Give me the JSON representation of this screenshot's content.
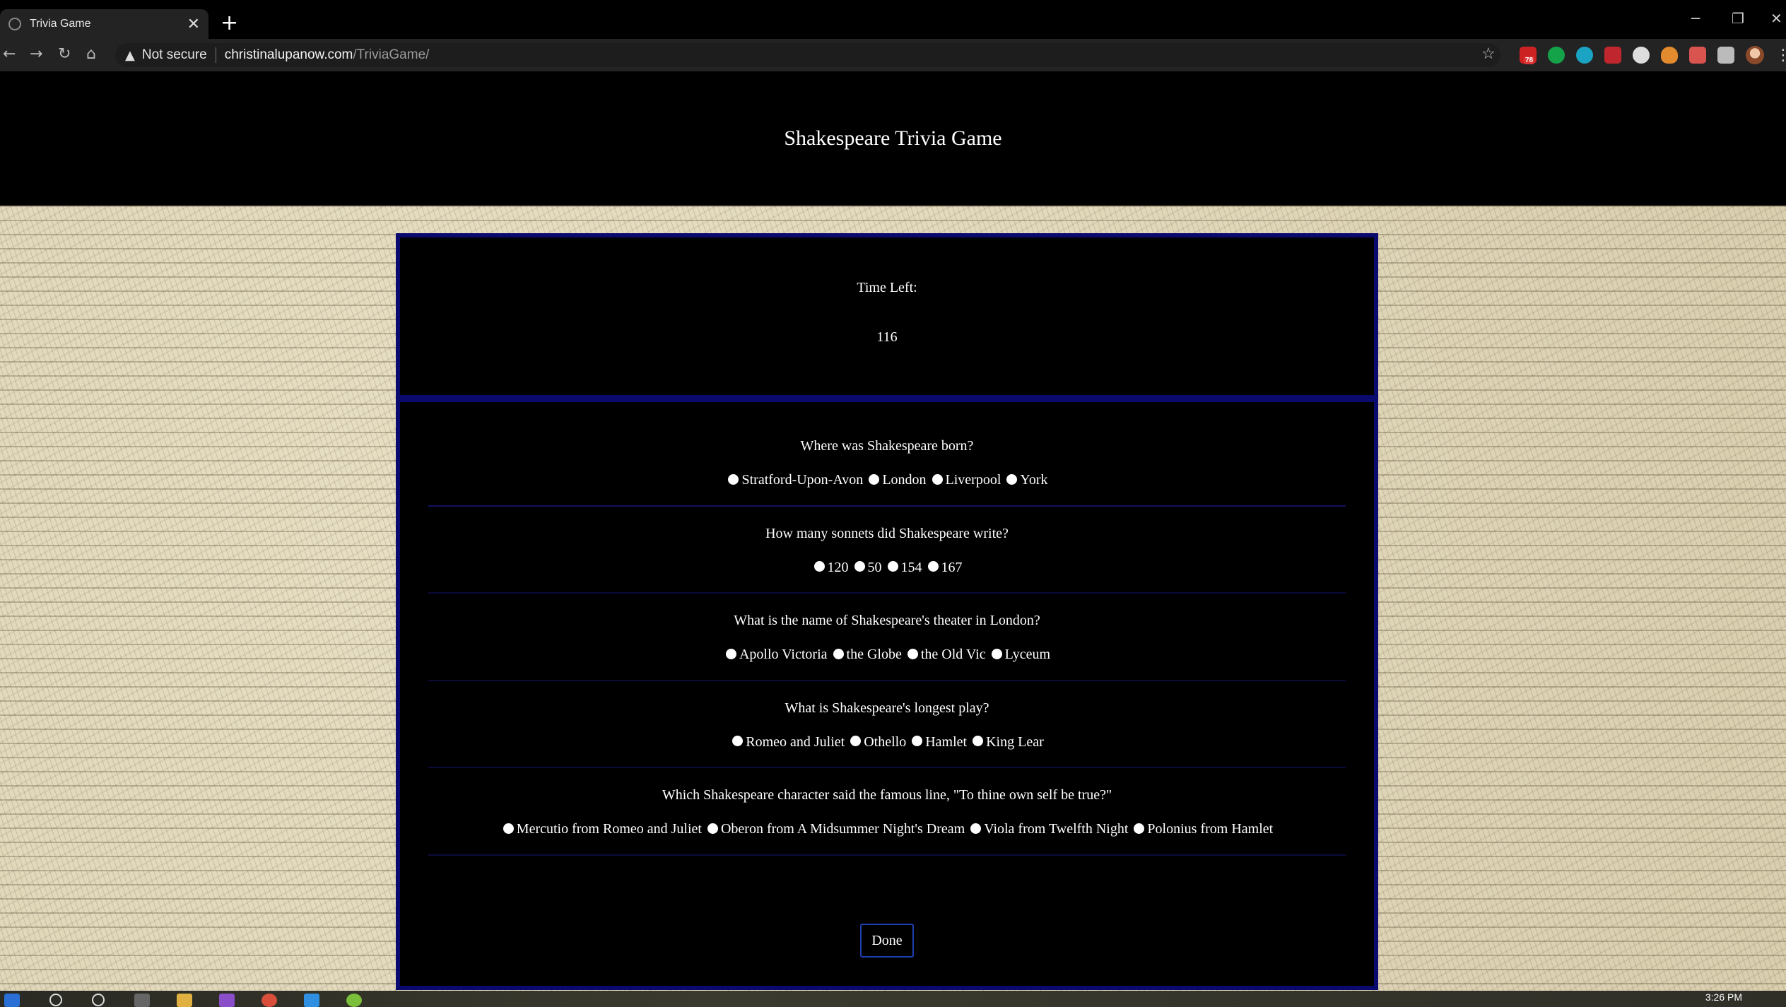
{
  "browser": {
    "tab_title": "Trivia Game",
    "tab_close": "✕",
    "new_tab": "+",
    "security_label": "Not secure",
    "url_host": "christinalupanow.com",
    "url_path": "/TriviaGame/",
    "extension_badge": "78",
    "icons": [
      "back-icon",
      "forward-icon",
      "reload-icon",
      "home-icon",
      "warning-icon",
      "star-icon",
      "puzzle-icon",
      "menu-icon"
    ]
  },
  "page": {
    "title": "Shakespeare Trivia Game",
    "timer_label": "Time Left:",
    "timer_value": "116",
    "questions": [
      {
        "text": "Where was Shakespeare born?",
        "options": [
          "Stratford-Upon-Avon",
          "London",
          "Liverpool",
          "York"
        ]
      },
      {
        "text": "How many sonnets did Shakespeare write?",
        "options": [
          "120",
          "50",
          "154",
          "167"
        ]
      },
      {
        "text": "What is the name of Shakespeare's theater in London?",
        "options": [
          "Apollo Victoria",
          "the Globe",
          "the Old Vic",
          "Lyceum"
        ]
      },
      {
        "text": "What is Shakespeare's longest play?",
        "options": [
          "Romeo and Juliet",
          "Othello",
          "Hamlet",
          "King Lear"
        ]
      },
      {
        "text": "Which Shakespeare character said the famous line, \"To thine own self be true?\"",
        "options": [
          "Mercutio from Romeo and Juliet",
          "Oberon from A Midsummer Night's Dream",
          "Viola from Twelfth Night",
          "Polonius from Hamlet"
        ]
      }
    ],
    "done_label": "Done"
  },
  "taskbar": {
    "clock": "3:26 PM"
  },
  "colors": {
    "panel_border": "#0a0a6e",
    "button_border": "#1f3fb0",
    "parchment": "#ddd3b4"
  }
}
